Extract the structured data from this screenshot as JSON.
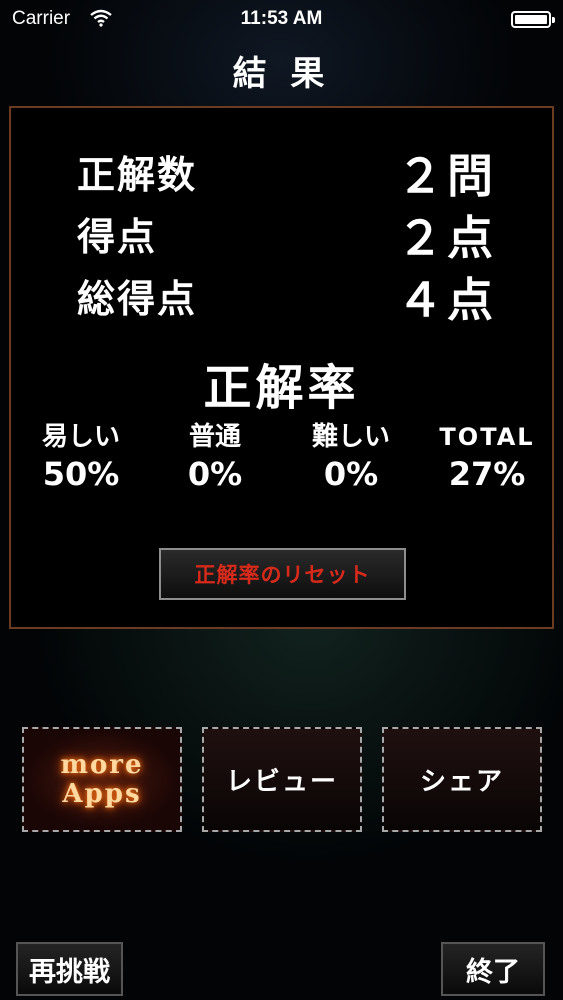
{
  "status_bar": {
    "carrier": "Carrier",
    "time": "11:53 AM"
  },
  "page_title": "結 果",
  "stats": [
    {
      "label": "正解数",
      "value": "２問"
    },
    {
      "label": "得点",
      "value": "２点"
    },
    {
      "label": "総得点",
      "value": "４点"
    }
  ],
  "rate_title": "正解率",
  "rates": [
    {
      "label": "易しい",
      "value": "50%"
    },
    {
      "label": "普通",
      "value": "0%"
    },
    {
      "label": "難しい",
      "value": "0%"
    },
    {
      "label": "TOTAL",
      "value": "27%"
    }
  ],
  "reset_label": "正解率のリセット",
  "menu": {
    "more_line1": "more",
    "more_line2": "Apps",
    "review": "レビュー",
    "share": "シェア"
  },
  "footer": {
    "retry": "再挑戦",
    "quit": "終了"
  },
  "colors": {
    "panel_border": "#6b3c22",
    "reset_text": "#d82a1a",
    "more_glow": "#ff7a1a"
  }
}
